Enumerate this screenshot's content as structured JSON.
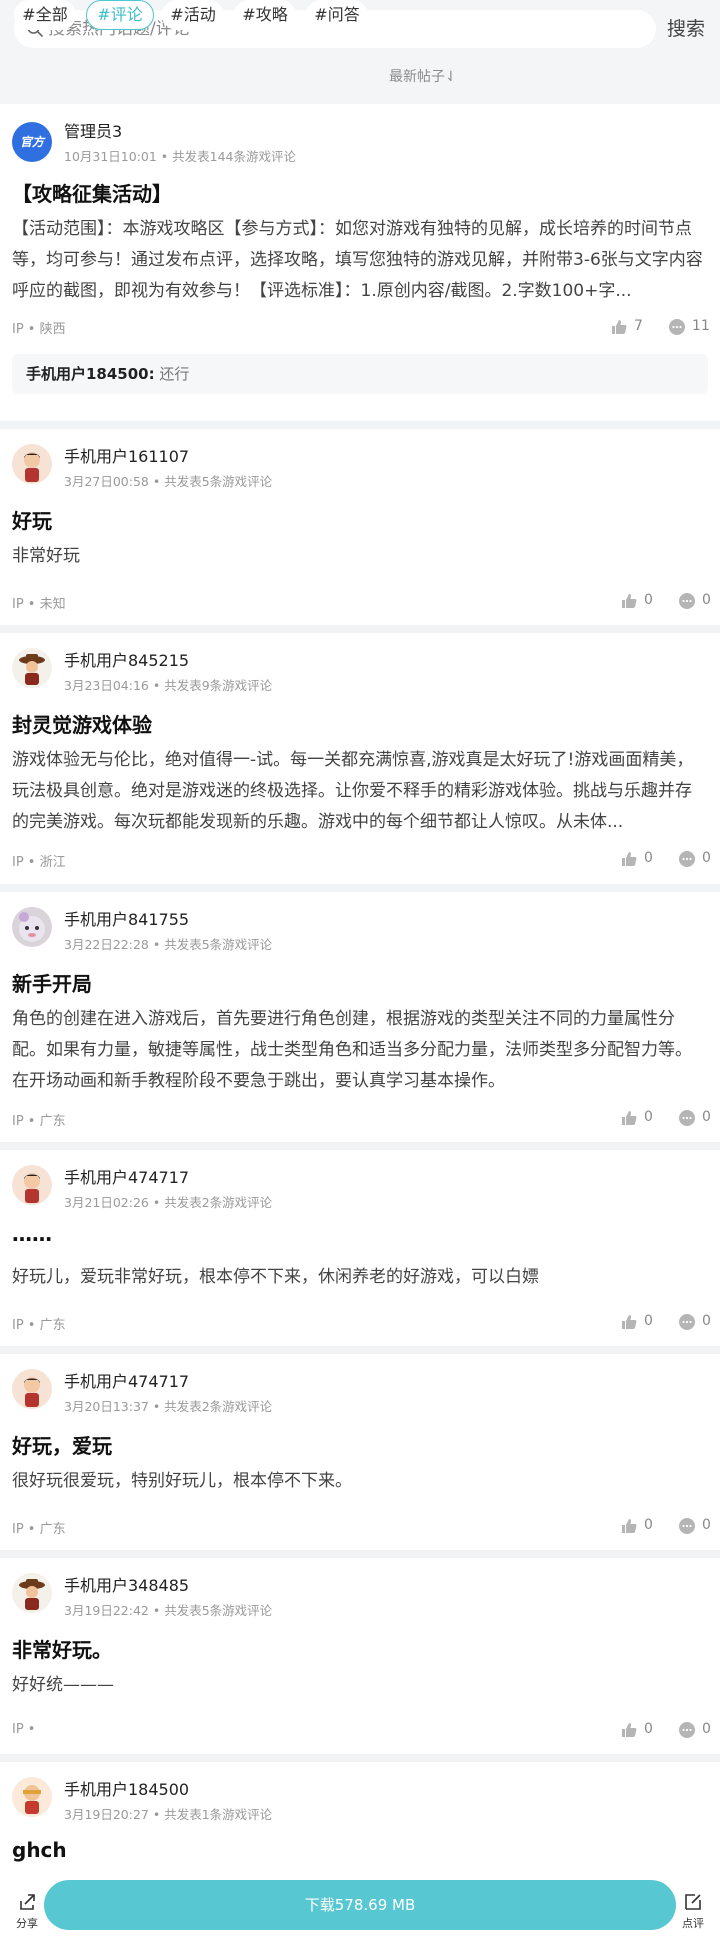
{
  "search": {
    "placeholder": "搜索热门话题/评论",
    "button": "搜索"
  },
  "tabs": [
    "#全部",
    "#评论",
    "#活动",
    "#攻略",
    "#问答"
  ],
  "sort_label": "最新帖子⇃",
  "posts": [
    {
      "user": "管理员3",
      "meta": "10月31日10:01 • 共发表144条游戏评论",
      "title": "【攻略征集活动】",
      "body": "【活动范围】：本游戏攻略区【参与方式】：如您对游戏有独特的见解，成长培养的时间节点等，均可参与！通过发布点评，选择攻略，填写您独特的游戏见解，并附带3-6张与文字内容呼应的截图，即视为有效参与！【评选标准】：1.原创内容/截图。2.字数100+字...",
      "ip": "IP • 陕西",
      "likes": "7",
      "comments": "11",
      "badge": "官方",
      "reply_user": "手机用户184500:",
      "reply_text": "还行"
    },
    {
      "user": "手机用户161107",
      "meta": "3月27日00:58 • 共发表5条游戏评论",
      "title": "好玩",
      "body": "非常好玩",
      "ip": "IP • 未知",
      "likes": "0",
      "comments": "0"
    },
    {
      "user": "手机用户845215",
      "meta": "3月23日04:16 • 共发表9条游戏评论",
      "title": "封灵觉游戏体验",
      "body": "游戏体验无与伦比，绝对值得一-试。每一关都充满惊喜,游戏真是太好玩了!游戏画面精美，玩法极具创意。绝对是游戏迷的终极选择。让你爱不释手的精彩游戏体验。挑战与乐趣并存的完美游戏。每次玩都能发现新的乐趣。游戏中的每个细节都让人惊叹。从未体...",
      "ip": "IP • 浙江",
      "likes": "0",
      "comments": "0"
    },
    {
      "user": "手机用户841755",
      "meta": "3月22日22:28 • 共发表5条游戏评论",
      "title": "新手开局",
      "body": "角色的创建在进入游戏后，首先要进行角色创建，根据游戏的类型关注不同的力量属性分配。如果有力量，敏捷等属性，战士类型角色和适当多分配力量，法师类型多分配智力等。在开场动画和新手教程阶段不要急于跳出，要认真学习基本操作。",
      "ip": "IP • 广东",
      "likes": "0",
      "comments": "0"
    },
    {
      "user": "手机用户474717",
      "meta": "3月21日02:26 • 共发表2条游戏评论",
      "title": "……",
      "body": "好玩儿，爱玩非常好玩，根本停不下来，休闲养老的好游戏，可以白嫖",
      "ip": "IP • 广东",
      "likes": "0",
      "comments": "0"
    },
    {
      "user": "手机用户474717",
      "meta": "3月20日13:37 • 共发表2条游戏评论",
      "title": "好玩，爱玩",
      "body": "很好玩很爱玩，特别好玩儿，根本停不下来。",
      "ip": "IP • 广东",
      "likes": "0",
      "comments": "0"
    },
    {
      "user": "手机用户348485",
      "meta": "3月19日22:42 • 共发表5条游戏评论",
      "title": "非常好玩。",
      "body": "好好统———",
      "ip": "IP •",
      "likes": "0",
      "comments": "0"
    },
    {
      "user": "手机用户184500",
      "meta": "3月19日20:27 • 共发表1条游戏评论",
      "title": "ghch",
      "body": "",
      "ip": "",
      "likes": "",
      "comments": ""
    }
  ],
  "bottom": {
    "share": "分享",
    "download": "下载578.69 MB",
    "rate": "点评"
  },
  "colors": {
    "accent": "#57c8d1",
    "official_badge": "#2f6fe0"
  }
}
